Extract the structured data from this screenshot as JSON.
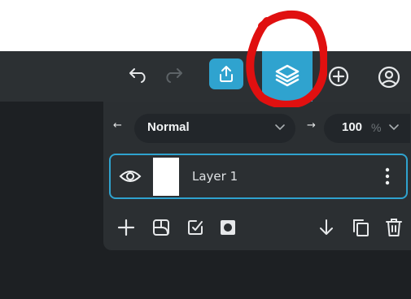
{
  "toolbar": {
    "undo_icon": "undo-icon",
    "redo_icon": "redo-icon",
    "upload_icon": "upload-icon",
    "layers_icon": "layers-icon",
    "add_icon": "plus-circle-icon",
    "account_icon": "user-circle-icon",
    "accent_color": "#2fa3cf"
  },
  "layers_panel": {
    "blend_mode": "Normal",
    "opacity_value": "100",
    "opacity_unit": "%",
    "layers": [
      {
        "name": "Layer 1",
        "visible": true,
        "selected": true
      }
    ],
    "actions": [
      "add-layer-icon",
      "merge-layer-icon",
      "apply-mask-icon",
      "mask-icon",
      "move-down-icon",
      "duplicate-icon",
      "delete-icon"
    ]
  },
  "annotation": {
    "color": "#e01010"
  }
}
